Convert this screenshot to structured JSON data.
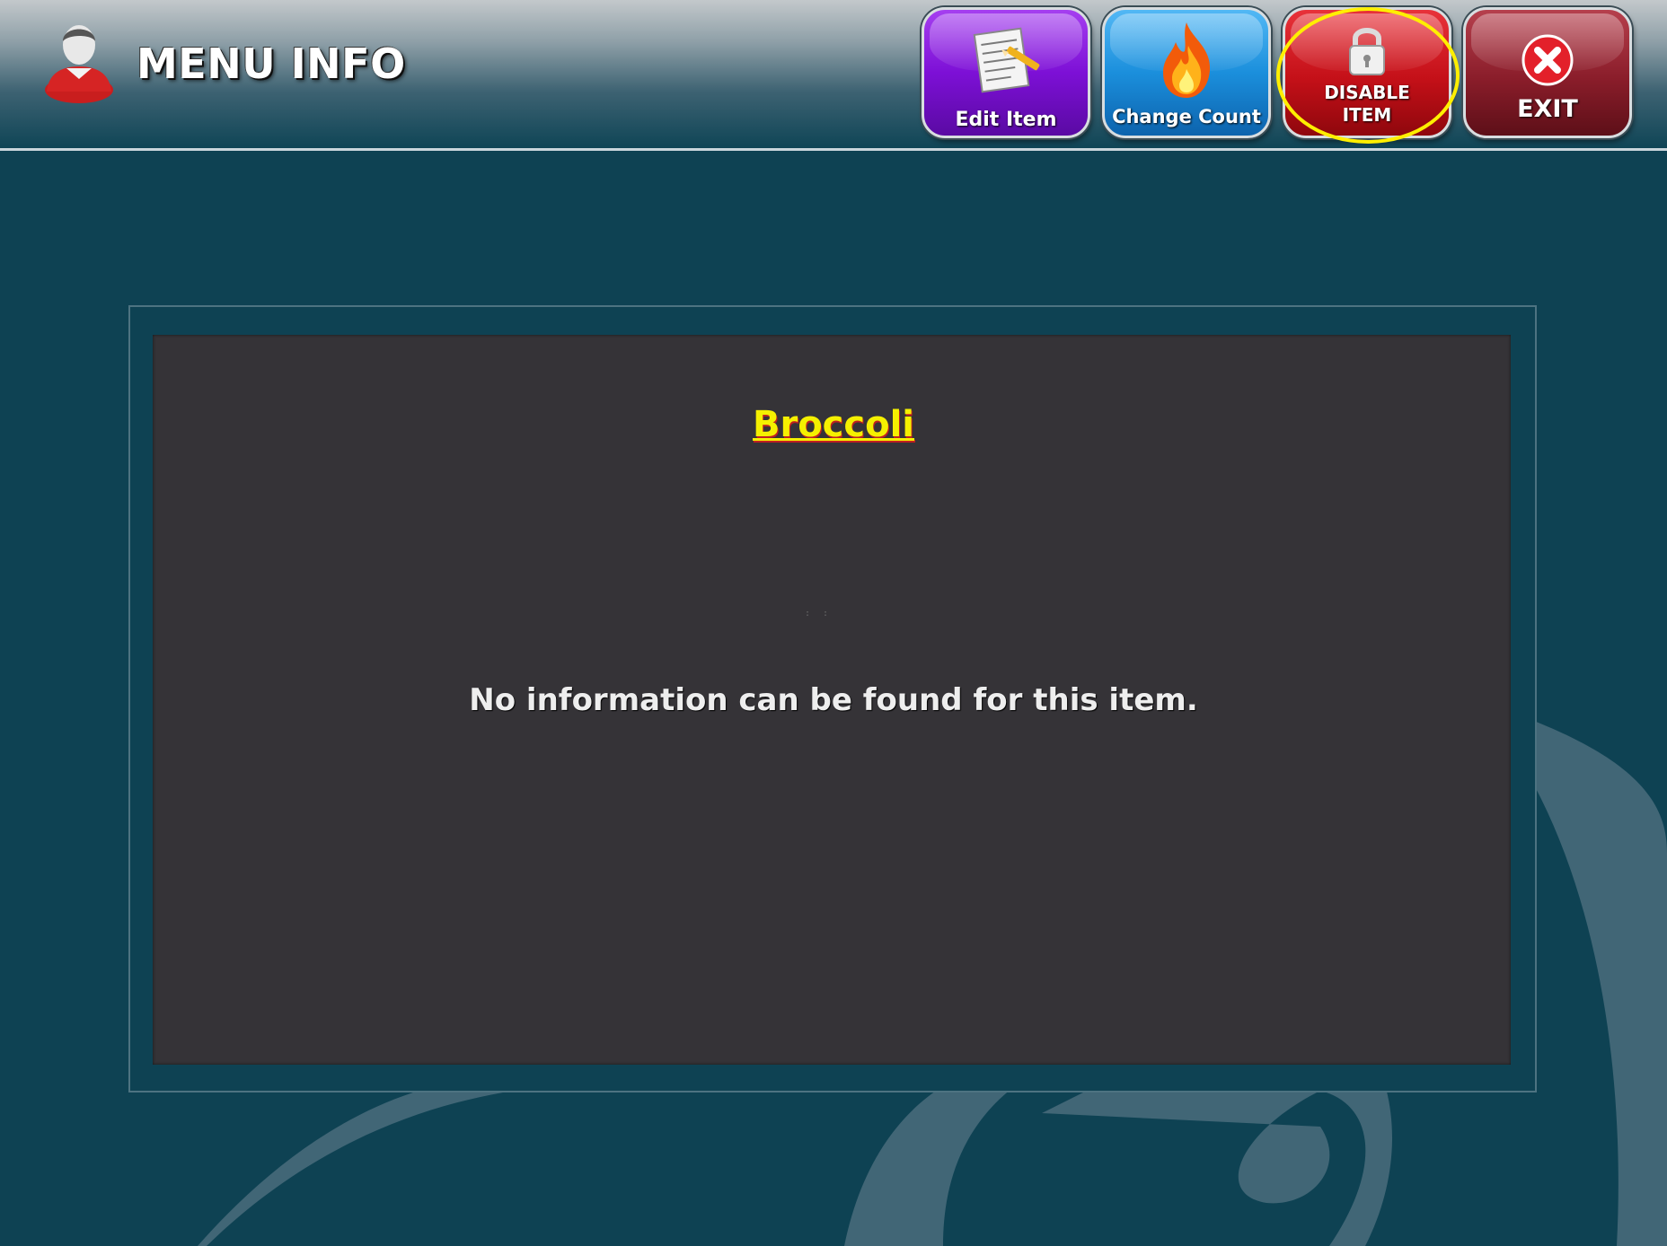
{
  "header": {
    "title": "MENU INFO",
    "user_icon": "user-icon"
  },
  "toolbar": {
    "edit_item": {
      "label": "Edit Item",
      "icon": "notepad-pencil-icon",
      "color": "#7d10d6"
    },
    "change_count": {
      "label": "Change Count",
      "icon": "flame-icon",
      "color": "#1b8fdc"
    },
    "disable_item": {
      "label_line1": "DISABLE",
      "label_line2": "ITEM",
      "icon": "padlock-icon",
      "color": "#c41018",
      "highlighted": true,
      "highlight_color": "#ffef00"
    },
    "exit": {
      "label": "EXIT",
      "icon": "close-x-icon",
      "color": "#8a1d2a"
    }
  },
  "panel": {
    "item_name": "Broccoli",
    "item_name_color": "#f5f000",
    "message": "No information can be found for this item."
  }
}
